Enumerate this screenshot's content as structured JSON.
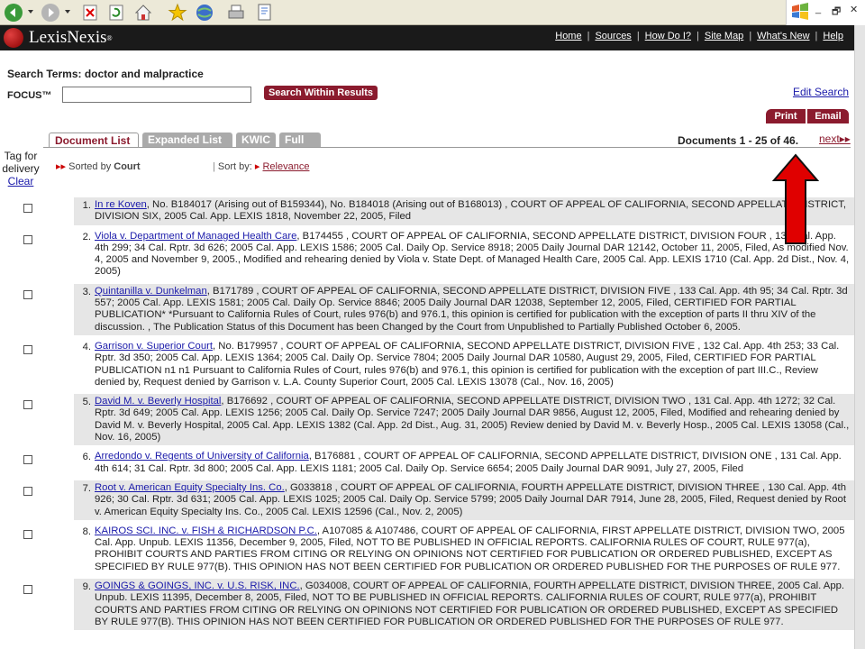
{
  "browser": {
    "window_controls": [
      "_",
      "🗗",
      "✕"
    ]
  },
  "header": {
    "logo_text": "LexisNexis",
    "logo_tm": "®",
    "nav": [
      "Home",
      "Sources",
      "How Do I?",
      "Site Map",
      "What's New",
      "Help"
    ]
  },
  "search": {
    "terms_label": "Search Terms: doctor and malpractice",
    "focus_label": "FOCUS™",
    "focus_value": "",
    "search_within_button": "Search Within Results",
    "edit_search": "Edit Search",
    "print": "Print",
    "email": "Email"
  },
  "tabs": [
    {
      "label": "Document List",
      "active": true
    },
    {
      "label": "Expanded List",
      "active": false
    },
    {
      "label": "KWIC",
      "active": false
    },
    {
      "label": "Full",
      "active": false
    }
  ],
  "pagination": {
    "documents": "Documents 1 - 25 of 46.",
    "next": "next"
  },
  "tag": {
    "label_1": "Tag for",
    "label_2": "delivery",
    "clear": "Clear"
  },
  "sort": {
    "sorted_prefix": "Sorted by",
    "sorted_value": "Court",
    "sort_by_label": "Sort by:",
    "sort_by_link": "Relevance"
  },
  "results": [
    {
      "num": "1.",
      "link": "In re Koven",
      "text": ", No. B184017 (Arising out of B159344), No. B184018 (Arising out of B168013) , COURT OF APPEAL OF CALIFORNIA, SECOND APPELLATE DISTRICT, DIVISION SIX, 2005 Cal. App. LEXIS 1818, November 22, 2005, Filed"
    },
    {
      "num": "2.",
      "link": "Viola v. Department of Managed Health Care",
      "text": ", B174455 , COURT OF APPEAL OF CALIFORNIA, SECOND APPELLATE DISTRICT, DIVISION FOUR , 133 Cal. App. 4th 299; 34 Cal. Rptr. 3d 626; 2005 Cal. App. LEXIS 1586; 2005 Cal. Daily Op. Service 8918; 2005 Daily Journal DAR 12142, October 11, 2005, Filed, As modified Nov. 4, 2005 and November 9, 2005., Modified and rehearing denied by Viola v. State Dept. of Managed Health Care, 2005 Cal. App. LEXIS 1710 (Cal. App. 2d Dist., Nov. 4, 2005)"
    },
    {
      "num": "3.",
      "link": "Quintanilla v. Dunkelman",
      "text": ", B171789 , COURT OF APPEAL OF CALIFORNIA, SECOND APPELLATE DISTRICT, DIVISION FIVE , 133 Cal. App. 4th 95; 34 Cal. Rptr. 3d 557; 2005 Cal. App. LEXIS 1581; 2005 Cal. Daily Op. Service 8846; 2005 Daily Journal DAR 12038, September 12, 2005, Filed, CERTIFIED FOR PARTIAL PUBLICATION* *Pursuant to California Rules of Court, rules 976(b) and 976.1, this opinion is certified for publication with the exception of parts II thru XIV of the discussion. , The Publication Status of this Document has been Changed by the Court from Unpublished to Partially Published October 6, 2005."
    },
    {
      "num": "4.",
      "link": "Garrison v. Superior Court",
      "text": ", No. B179957 , COURT OF APPEAL OF CALIFORNIA, SECOND APPELLATE DISTRICT, DIVISION FIVE , 132 Cal. App. 4th 253; 33 Cal. Rptr. 3d 350; 2005 Cal. App. LEXIS 1364; 2005 Cal. Daily Op. Service 7804; 2005 Daily Journal DAR 10580, August 29, 2005, Filed, CERTIFIED FOR PARTIAL PUBLICATION n1 n1 Pursuant to California Rules of Court, rules 976(b) and 976.1, this opinion is certified for publication with the exception of part III.C., Review denied by, Request denied by Garrison v. L.A. County Superior Court, 2005 Cal. LEXIS 13078 (Cal., Nov. 16, 2005)"
    },
    {
      "num": "5.",
      "link": "David M. v. Beverly Hospital",
      "text": ", B176692 , COURT OF APPEAL OF CALIFORNIA, SECOND APPELLATE DISTRICT, DIVISION TWO , 131 Cal. App. 4th 1272; 32 Cal. Rptr. 3d 649; 2005 Cal. App. LEXIS 1256; 2005 Cal. Daily Op. Service 7247; 2005 Daily Journal DAR 9856, August 12, 2005, Filed, Modified and rehearing denied by David M. v. Beverly Hospital, 2005 Cal. App. LEXIS 1382 (Cal. App. 2d Dist., Aug. 31, 2005) Review denied by David M. v. Beverly Hosp., 2005 Cal. LEXIS 13058 (Cal., Nov. 16, 2005)"
    },
    {
      "num": "6.",
      "link": "Arredondo v. Regents of University of California",
      "text": ", B176881 , COURT OF APPEAL OF CALIFORNIA, SECOND APPELLATE DISTRICT, DIVISION ONE , 131 Cal. App. 4th 614; 31 Cal. Rptr. 3d 800; 2005 Cal. App. LEXIS 1181; 2005 Cal. Daily Op. Service 6654; 2005 Daily Journal DAR 9091, July 27, 2005, Filed"
    },
    {
      "num": "7.",
      "link": "Root v. American Equity Specialty Ins. Co.",
      "text": ", G033818 , COURT OF APPEAL OF CALIFORNIA, FOURTH APPELLATE DISTRICT, DIVISION THREE , 130 Cal. App. 4th 926; 30 Cal. Rptr. 3d 631; 2005 Cal. App. LEXIS 1025; 2005 Cal. Daily Op. Service 5799; 2005 Daily Journal DAR 7914, June 28, 2005, Filed, Request denied by Root v. American Equity Specialty Ins. Co., 2005 Cal. LEXIS 12596 (Cal., Nov. 2, 2005)"
    },
    {
      "num": "8.",
      "link": "KAIROS SCI. INC. v. FISH & RICHARDSON P.C.",
      "text": ", A107085 & A107486, COURT OF APPEAL OF CALIFORNIA, FIRST APPELLATE DISTRICT, DIVISION TWO, 2005 Cal. App. Unpub. LEXIS 11356, December 9, 2005, Filed, NOT TO BE PUBLISHED IN OFFICIAL REPORTS. CALIFORNIA RULES OF COURT, RULE 977(a), PROHIBIT COURTS AND PARTIES FROM CITING OR RELYING ON OPINIONS NOT CERTIFIED FOR PUBLICATION OR ORDERED PUBLISHED, EXCEPT AS SPECIFIED BY RULE 977(B). THIS OPINION HAS NOT BEEN CERTIFIED FOR PUBLICATION OR ORDERED PUBLISHED FOR THE PURPOSES OF RULE 977."
    },
    {
      "num": "9.",
      "link": "GOINGS & GOINGS, INC. v. U.S. RISK, INC.",
      "text": ", G034008, COURT OF APPEAL OF CALIFORNIA, FOURTH APPELLATE DISTRICT, DIVISION THREE, 2005 Cal. App. Unpub. LEXIS 11395, December 8, 2005, Filed, NOT TO BE PUBLISHED IN OFFICIAL REPORTS. CALIFORNIA RULES OF COURT, RULE 977(a), PROHIBIT COURTS AND PARTIES FROM CITING OR RELYING ON OPINIONS NOT CERTIFIED FOR PUBLICATION OR ORDERED PUBLISHED, EXCEPT AS SPECIFIED BY RULE 977(B). THIS OPINION HAS NOT BEEN CERTIFIED FOR PUBLICATION OR ORDERED PUBLISHED FOR THE PURPOSES OF RULE 977."
    }
  ],
  "colors": {
    "brand": "#8b1b2e",
    "link": "#1a1aaa",
    "row_shade": "#e6e6e6",
    "annotation_arrow": "#e00000"
  }
}
